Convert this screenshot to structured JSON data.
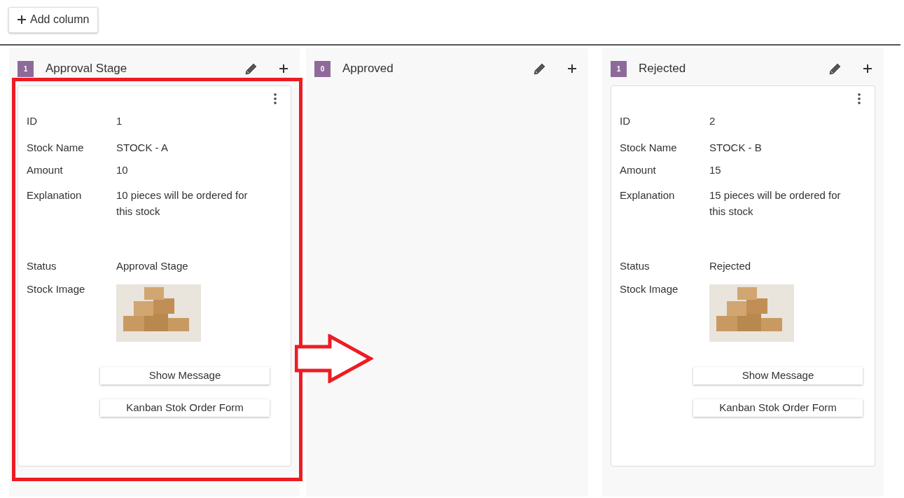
{
  "toolbar": {
    "add_column_button": "Add column"
  },
  "columns": [
    {
      "count": "1",
      "title": "Approval Stage",
      "cards": [
        {
          "highlighted": true,
          "fields": [
            {
              "label": "ID",
              "value": "1"
            },
            {
              "label": "Stock Name",
              "value": "STOCK - A"
            },
            {
              "label": "Amount",
              "value": "10"
            },
            {
              "label": "Explanation",
              "value": "10 pieces will be ordered for this stock"
            },
            {
              "label": "Status",
              "value": "Approval Stage"
            },
            {
              "label": "Stock Image",
              "kind": "image"
            }
          ],
          "buttons": [
            "Show Message",
            "Kanban Stok Order Form"
          ]
        }
      ]
    },
    {
      "count": "0",
      "title": "Approved"
    },
    {
      "count": "1",
      "title": "Rejected",
      "cards": [
        {
          "highlighted": false,
          "fields": [
            {
              "label": "ID",
              "value": "2"
            },
            {
              "label": "Stock Name",
              "value": "STOCK - B"
            },
            {
              "label": "Amount",
              "value": "15"
            },
            {
              "label": "Explanation",
              "value": "15 pieces will be ordered for this stock"
            },
            {
              "label": "Status",
              "value": "Rejected"
            },
            {
              "label": "Stock Image",
              "kind": "image"
            }
          ],
          "buttons": [
            "Show Message",
            "Kanban Stok Order Form"
          ]
        }
      ]
    }
  ]
}
